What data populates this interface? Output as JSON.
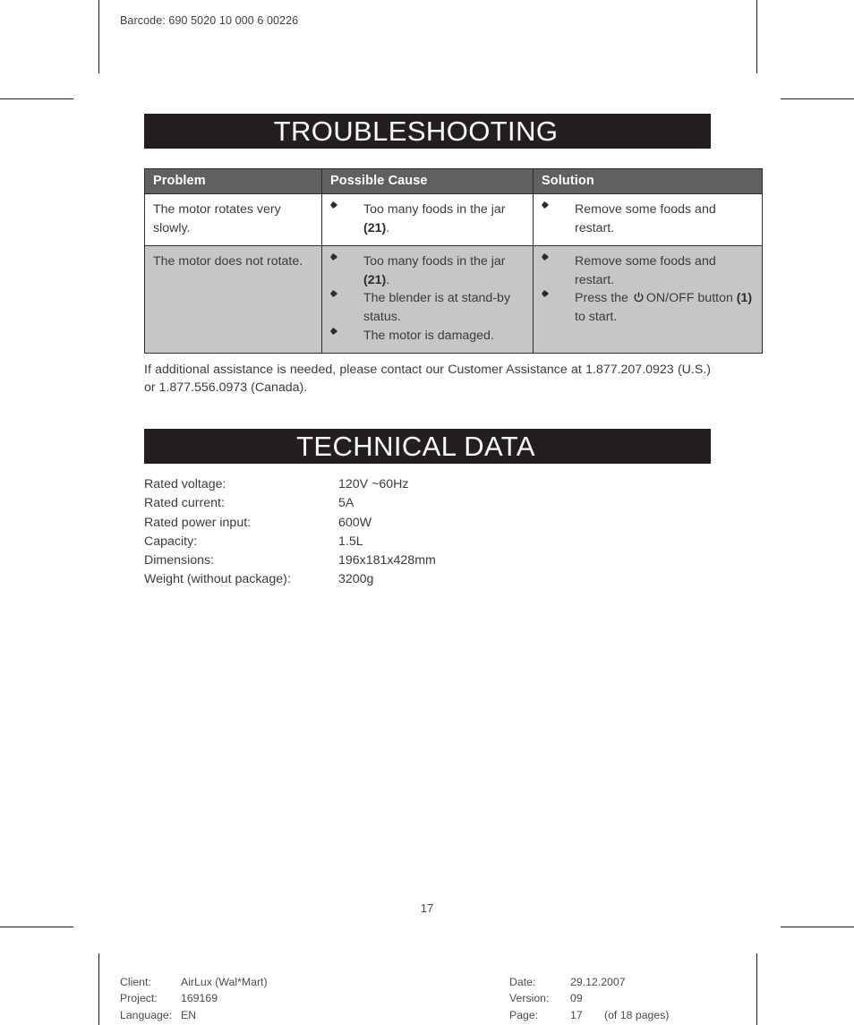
{
  "barcode": {
    "label": "Barcode: 690 5020 10 000 6 00226"
  },
  "sections": {
    "troubleshooting": {
      "title": "TROUBLESHOOTING",
      "table": {
        "headers": [
          "Problem",
          "Possible Cause",
          "Solution"
        ],
        "rows": [
          {
            "problem": "The motor rotates very slowly.",
            "causes": [
              {
                "text": "Too many foods in the jar ",
                "ref": "(21)",
                "tail": "."
              }
            ],
            "solutions": [
              {
                "text": "Remove some foods and restart."
              }
            ]
          },
          {
            "problem": "The motor does not rotate.",
            "causes": [
              {
                "text": "Too many foods in the jar ",
                "ref": "(21)",
                "tail": "."
              },
              {
                "text": "The blender is at stand-by status."
              },
              {
                "text": "The motor is damaged."
              }
            ],
            "solutions": [
              {
                "text": "Remove some foods and restart."
              },
              {
                "pre": "Press the ",
                "icon": "power-icon",
                "mid": "ON/OFF button ",
                "ref": "(1)",
                "tail": " to start."
              }
            ]
          }
        ]
      },
      "assistance": "If additional assistance is needed, please contact our Customer Assistance at 1.877.207.0923 (U.S.) or 1.877.556.0973 (Canada)."
    },
    "technical_data": {
      "title": "TECHNICAL DATA",
      "specs": [
        {
          "label": "Rated voltage:",
          "value": "120V ~60Hz"
        },
        {
          "label": "Rated current:",
          "value": "5A"
        },
        {
          "label": "Rated power input:",
          "value": "600W"
        },
        {
          "label": "Capacity:",
          "value": "1.5L"
        },
        {
          "label": "Dimensions:",
          "value": "196x181x428mm"
        },
        {
          "label": "Weight (without package):",
          "value": "3200g"
        }
      ]
    }
  },
  "page_number": "17",
  "footer": {
    "left": [
      {
        "label": "Client:",
        "value": "AirLux (Wal*Mart)"
      },
      {
        "label": "Project:",
        "value": "169169"
      },
      {
        "label": "Language:",
        "value": "EN"
      }
    ],
    "right": [
      {
        "label": "Date:",
        "value": "29.12.2007"
      },
      {
        "label": "Version:",
        "value": "09"
      },
      {
        "label": "Page:",
        "value": "17",
        "note": "(of 18 pages)"
      }
    ]
  },
  "colors": {
    "band": "#231f20",
    "table_header": "#606060",
    "row_alt": "#c6c6c6",
    "text": "#3b3b3b",
    "rule": "#1a1a1a"
  }
}
